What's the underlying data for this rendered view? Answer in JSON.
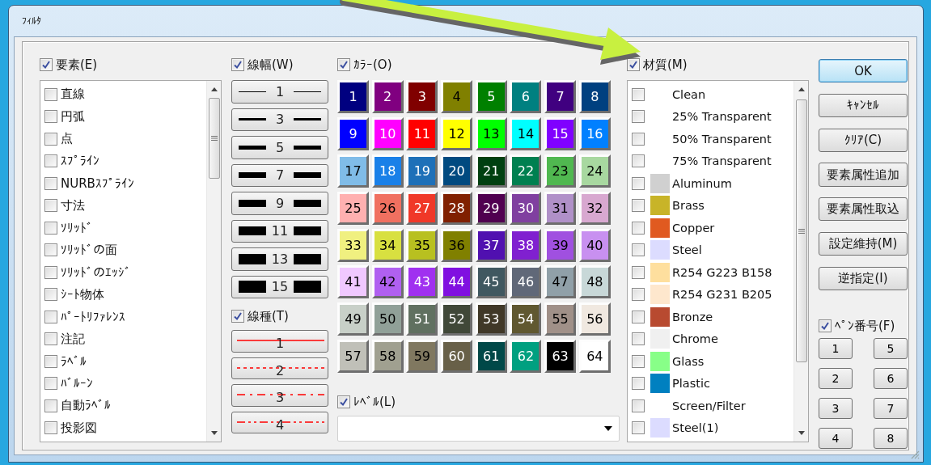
{
  "window": {
    "title": "ﾌｨﾙﾀ"
  },
  "elements": {
    "label": "要素(E)",
    "checked": true,
    "items": [
      {
        "label": "直線",
        "checked": false
      },
      {
        "label": "円弧",
        "checked": false
      },
      {
        "label": "点",
        "checked": false
      },
      {
        "label": "ｽﾌﾟﾗｲﾝ",
        "checked": false
      },
      {
        "label": "NURBｽﾌﾟﾗｲﾝ",
        "checked": false
      },
      {
        "label": "寸法",
        "checked": false
      },
      {
        "label": "ｿﾘｯﾄﾞ",
        "checked": false
      },
      {
        "label": "ｿﾘｯﾄﾞの面",
        "checked": false
      },
      {
        "label": "ｿﾘｯﾄﾞのｴｯｼﾞ",
        "checked": false
      },
      {
        "label": "ｼｰﾄ物体",
        "checked": false
      },
      {
        "label": "ﾊﾟｰﾄﾘﾌｧﾚﾝｽ",
        "checked": false
      },
      {
        "label": "注記",
        "checked": false
      },
      {
        "label": "ﾗﾍﾞﾙ",
        "checked": false
      },
      {
        "label": "ﾊﾞﾙｰﾝ",
        "checked": false
      },
      {
        "label": "自動ﾗﾍﾞﾙ",
        "checked": false
      },
      {
        "label": "投影図",
        "checked": false
      }
    ]
  },
  "line_width": {
    "label": "線幅(W)",
    "checked": true,
    "buttons": [
      "1",
      "3",
      "5",
      "7",
      "9",
      "11",
      "13",
      "15"
    ]
  },
  "line_type": {
    "label": "線種(T)",
    "checked": true,
    "buttons": [
      {
        "label": "1",
        "kind": "solid"
      },
      {
        "label": "2",
        "kind": "dotted"
      },
      {
        "label": "3",
        "kind": "dashdot"
      },
      {
        "label": "4",
        "kind": "dashdotdot"
      }
    ]
  },
  "color": {
    "label": "ｶﾗｰ(O)",
    "checked": true,
    "swatches": [
      {
        "label": "1",
        "color": "#000080"
      },
      {
        "label": "2",
        "color": "#800080"
      },
      {
        "label": "3",
        "color": "#800000"
      },
      {
        "label": "4",
        "color": "#808000"
      },
      {
        "label": "5",
        "color": "#008000"
      },
      {
        "label": "6",
        "color": "#008080"
      },
      {
        "label": "7",
        "color": "#400080"
      },
      {
        "label": "8",
        "color": "#004080"
      },
      {
        "label": "9",
        "color": "#0000ff"
      },
      {
        "label": "10",
        "color": "#ff00ff"
      },
      {
        "label": "11",
        "color": "#ff0000"
      },
      {
        "label": "12",
        "color": "#ffff00"
      },
      {
        "label": "13",
        "color": "#00ff00"
      },
      {
        "label": "14",
        "color": "#00ffff"
      },
      {
        "label": "15",
        "color": "#8000ff"
      },
      {
        "label": "16",
        "color": "#0080ff"
      },
      {
        "label": "17",
        "color": "#80bce8"
      },
      {
        "label": "18",
        "color": "#1a80e8"
      },
      {
        "label": "19",
        "color": "#1e70b8"
      },
      {
        "label": "20",
        "color": "#004a80"
      },
      {
        "label": "21",
        "color": "#004010"
      },
      {
        "label": "22",
        "color": "#008050"
      },
      {
        "label": "23",
        "color": "#50b850"
      },
      {
        "label": "24",
        "color": "#a8d8a0"
      },
      {
        "label": "25",
        "color": "#ffb0b0"
      },
      {
        "label": "26",
        "color": "#f07060"
      },
      {
        "label": "27",
        "color": "#f03828"
      },
      {
        "label": "28",
        "color": "#802000"
      },
      {
        "label": "29",
        "color": "#500050"
      },
      {
        "label": "30",
        "color": "#8040a0"
      },
      {
        "label": "31",
        "color": "#b090c8"
      },
      {
        "label": "32",
        "color": "#d8a8d0"
      },
      {
        "label": "33",
        "color": "#f0f080"
      },
      {
        "label": "34",
        "color": "#d8e040"
      },
      {
        "label": "35",
        "color": "#b8c020"
      },
      {
        "label": "36",
        "color": "#808000"
      },
      {
        "label": "37",
        "color": "#5010b0"
      },
      {
        "label": "38",
        "color": "#8020d0"
      },
      {
        "label": "39",
        "color": "#a050e0"
      },
      {
        "label": "40",
        "color": "#c890f0"
      },
      {
        "label": "41",
        "color": "#f0c8ff"
      },
      {
        "label": "42",
        "color": "#b060f0"
      },
      {
        "label": "43",
        "color": "#a030f0"
      },
      {
        "label": "44",
        "color": "#8010e0"
      },
      {
        "label": "45",
        "color": "#405860"
      },
      {
        "label": "46",
        "color": "#606878"
      },
      {
        "label": "47",
        "color": "#90a0a8"
      },
      {
        "label": "48",
        "color": "#c8d8d8"
      },
      {
        "label": "49",
        "color": "#c8d0c8"
      },
      {
        "label": "50",
        "color": "#90a098"
      },
      {
        "label": "51",
        "color": "#607060"
      },
      {
        "label": "52",
        "color": "#404838"
      },
      {
        "label": "53",
        "color": "#403828"
      },
      {
        "label": "54",
        "color": "#605830"
      },
      {
        "label": "55",
        "color": "#a09088"
      },
      {
        "label": "56",
        "color": "#f0e8e0"
      },
      {
        "label": "57",
        "color": "#c0c0b8"
      },
      {
        "label": "58",
        "color": "#a0a090"
      },
      {
        "label": "59",
        "color": "#807860"
      },
      {
        "label": "60",
        "color": "#686048"
      },
      {
        "label": "61",
        "color": "#004848"
      },
      {
        "label": "62",
        "color": "#00a080"
      },
      {
        "label": "63",
        "color": "#000000"
      },
      {
        "label": "64",
        "color": "#ffffff"
      }
    ]
  },
  "level": {
    "label": "ﾚﾍﾞﾙ(L)",
    "checked": true
  },
  "material": {
    "label": "材質(M)",
    "checked": true,
    "items": [
      {
        "label": "Clean",
        "checked": false
      },
      {
        "label": "25% Transparent",
        "checked": false
      },
      {
        "label": "50% Transparent",
        "checked": false
      },
      {
        "label": "75% Transparent",
        "checked": false
      },
      {
        "label": "Aluminum",
        "checked": false,
        "color": "#d0d0d0"
      },
      {
        "label": "Brass",
        "checked": false,
        "color": "#c8b428"
      },
      {
        "label": "Copper",
        "checked": false,
        "color": "#e05a20"
      },
      {
        "label": "Steel",
        "checked": false,
        "color": "#dcdcff"
      },
      {
        "label": "R254 G223 B158",
        "checked": false,
        "color": "#fedf9e"
      },
      {
        "label": "R254 G231 B205",
        "checked": false,
        "color": "#fee7cd"
      },
      {
        "label": "Bronze",
        "checked": false,
        "color": "#b84a30"
      },
      {
        "label": "Chrome",
        "checked": false,
        "color": "#f0f0f0"
      },
      {
        "label": "Glass",
        "checked": false,
        "color": "#88ff88"
      },
      {
        "label": "Plastic",
        "checked": false,
        "color": "#0080c0"
      },
      {
        "label": "Screen/Filter",
        "checked": false
      },
      {
        "label": "Steel(1)",
        "checked": false,
        "color": "#dcdcff"
      }
    ]
  },
  "buttons": [
    {
      "label": "OK",
      "default": true
    },
    {
      "label": "ｷｬﾝｾﾙ",
      "default": false
    },
    {
      "label": "ｸﾘｱ(C)",
      "default": false
    },
    {
      "label": "要素属性追加",
      "default": false
    },
    {
      "label": "要素属性取込",
      "default": false
    },
    {
      "label": "設定維持(M)",
      "default": false
    },
    {
      "label": "逆指定(I)",
      "default": false
    }
  ],
  "pen_number": {
    "label": "ﾍﾟﾝ番号(F)",
    "checked": true,
    "buttons": [
      "1",
      "2",
      "3",
      "4",
      "5",
      "6",
      "7",
      "8"
    ]
  }
}
